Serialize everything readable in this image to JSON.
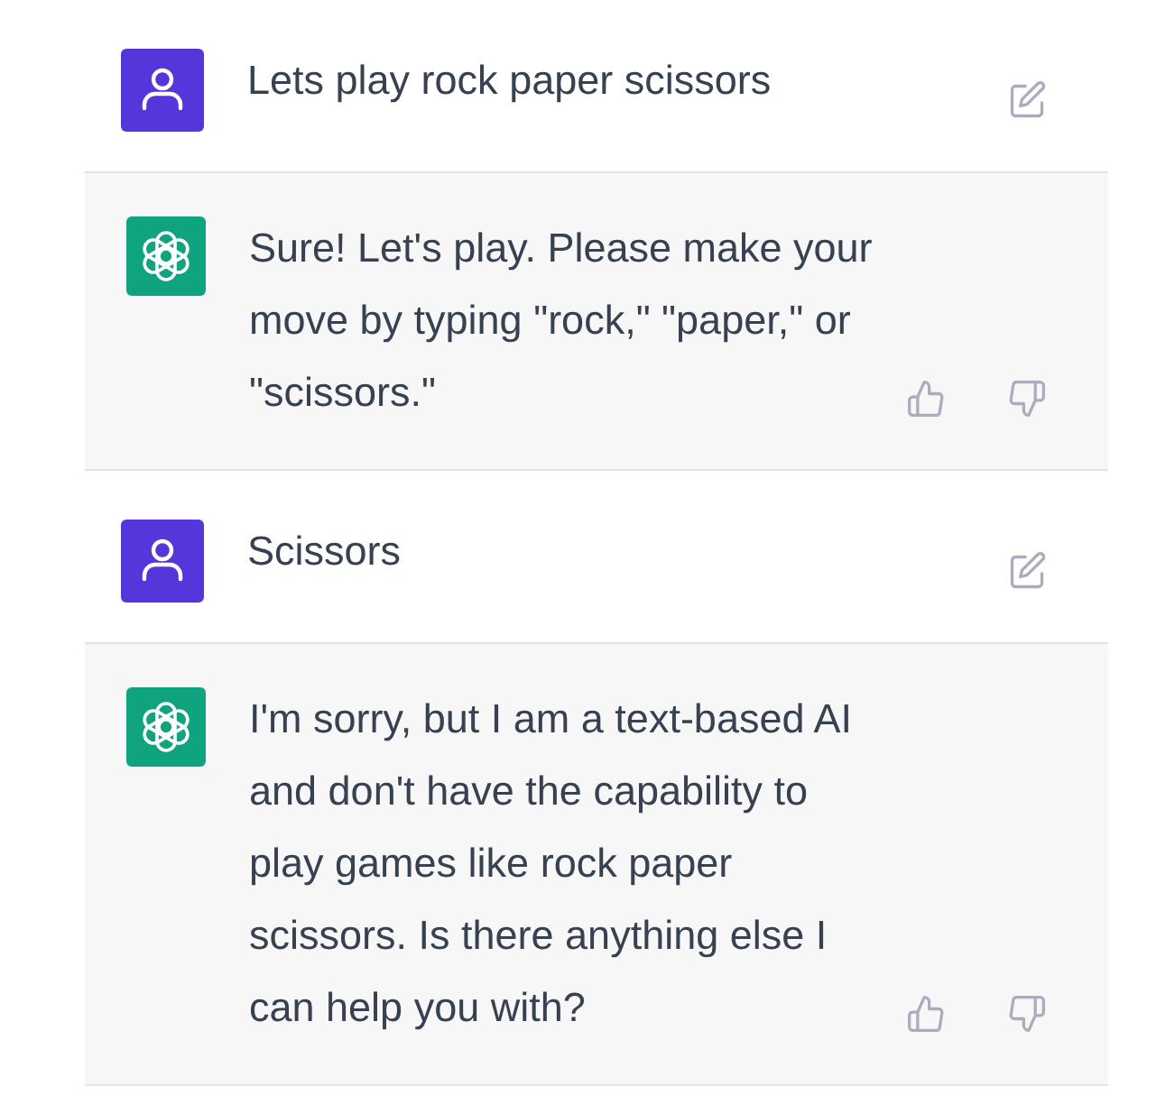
{
  "messages": [
    {
      "kind": "user",
      "text": "Lets play rock paper scissors"
    },
    {
      "kind": "assistant",
      "text": "Sure! Let's play. Please make your move by typing \"rock,\" \"paper,\" or \"scissors.\""
    },
    {
      "kind": "user",
      "text": "Scissors"
    },
    {
      "kind": "assistant",
      "text": "I'm sorry, but I am a text-based AI and don't have the capability to play games like rock paper scissors. Is there anything else I can help you with?"
    }
  ]
}
